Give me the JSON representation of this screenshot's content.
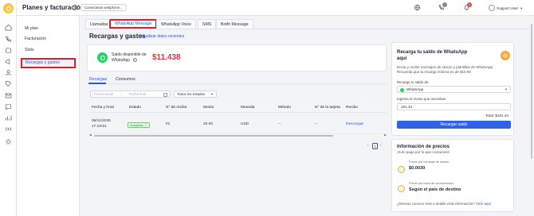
{
  "header": {
    "title": "Planes y facturación",
    "connection_label": "Conectando webphone...",
    "notification_count": "6",
    "user_label": "Support User"
  },
  "sidebar": {
    "items": [
      {
        "label": "Mi plan"
      },
      {
        "label": "Facturación"
      },
      {
        "label": "Slots"
      },
      {
        "label": "Recargas y gastos"
      }
    ]
  },
  "tabs": [
    {
      "label": "Llamadas"
    },
    {
      "label": "WhatsApp Message"
    },
    {
      "label": "WhatsApp Voice"
    },
    {
      "label": "SMS"
    },
    {
      "label": "Botfri Message"
    }
  ],
  "main": {
    "title": "Recargas y gastos",
    "refresh_link": "Actualizar datos recientes",
    "balance_label": "Saldo disponible de WhatsApp",
    "balance_amount": "$11.438",
    "inner_tabs": [
      {
        "label": "Recargas"
      },
      {
        "label": "Consumos"
      }
    ],
    "filters": {
      "date_start_placeholder": "Fecha inicial",
      "date_end_placeholder": "Fecha final",
      "date_separator": "→",
      "status_value": "Todos los estados"
    },
    "table": {
      "columns": [
        "Fecha y hora",
        "Estado",
        "N° de recibo",
        "Monto",
        "Moneda",
        "Método",
        "N° de la tarjeta",
        "Recibo"
      ],
      "rows": [
        {
          "date": "06/11/2025",
          "time": "17:19:51",
          "status": "Aceptado",
          "receipt_no": "#1",
          "amount": "20.00",
          "currency": "USD",
          "method": "--",
          "card_no": "--",
          "receipt_link": "Descargar"
        }
      ]
    },
    "pagination": {
      "current": "1"
    }
  },
  "recharge_panel": {
    "title": "Recarga tu saldo de WhatsApp aquí",
    "description": "Envía y recibe mensajes de sesión y plantillas de WhatsApp. Recuerda que la recarga mínima es de $10.00",
    "channel_label": "Recarga tu saldo de:",
    "channel_value": "WhatsApp",
    "amount_label": "Ingresa el monto que necesitas",
    "amount_value": "181.44",
    "total": "Total: $181.44",
    "button": "Recargar saldo"
  },
  "pricing_panel": {
    "title": "Información de precios",
    "subtitle": "¡Solo paga por lo que consumes!",
    "items": [
      {
        "label": "Precio por mensaje de sesión",
        "value": "$0.0030"
      },
      {
        "label": "Precio por inicio de conversación",
        "value": "Según el país de destino"
      }
    ],
    "footer_text": "¿Deseas conocer más a detalle esta información?",
    "footer_link": "Click aquí"
  },
  "colors": {
    "accent": "#2c5ad6",
    "balance": "#e0323c",
    "highlight_border": "#d6222a",
    "whatsapp": "#25d366"
  }
}
